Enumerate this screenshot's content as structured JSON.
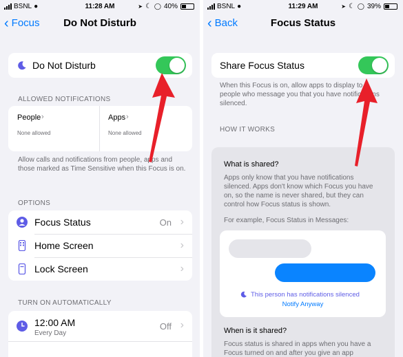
{
  "left": {
    "status": {
      "carrier": "BSNL",
      "time": "11:28 AM",
      "battery": "40%",
      "battery_level": 0.4
    },
    "nav": {
      "back_label": "Focus",
      "title": "Do Not Disturb"
    },
    "dnd_row": {
      "label": "Do Not Disturb",
      "toggle_on": true
    },
    "allowed": {
      "header": "ALLOWED NOTIFICATIONS",
      "people": {
        "title": "People",
        "sub": "None allowed"
      },
      "apps": {
        "title": "Apps",
        "sub": "None allowed"
      },
      "footer": "Allow calls and notifications from people, apps and those marked as Time Sensitive when this Focus is on."
    },
    "options": {
      "header": "OPTIONS",
      "items": [
        {
          "label": "Focus Status",
          "value": "On",
          "icon": "focus-status-icon"
        },
        {
          "label": "Home Screen",
          "value": "",
          "icon": "home-screen-icon"
        },
        {
          "label": "Lock Screen",
          "value": "",
          "icon": "lock-screen-icon"
        }
      ]
    },
    "auto": {
      "header": "TURN ON AUTOMATICALLY",
      "item": {
        "time": "12:00 AM",
        "sub": "Every Day",
        "value": "Off",
        "icon": "clock-icon"
      }
    }
  },
  "right": {
    "status": {
      "carrier": "BSNL",
      "time": "11:29 AM",
      "battery": "39%",
      "battery_level": 0.39
    },
    "nav": {
      "back_label": "Back",
      "title": "Focus Status"
    },
    "share_row": {
      "label": "Share Focus Status",
      "toggle_on": true
    },
    "share_footer": "When this Focus is on, allow apps to display to people who message you that you have notifications silenced.",
    "how_header": "HOW IT WORKS",
    "info": {
      "what_title": "What is shared?",
      "what_body": "Apps only know that you have notifications silenced. Apps don't know which Focus you have on, so the name is never shared, but they can control how Focus status is shown.",
      "example": "For example, Focus Status in Messages:",
      "silenced_text": "This person has notifications silenced",
      "notify_anyway": "Notify Anyway",
      "when_title": "When is it shared?",
      "when_body": "Focus status is shared in apps when you have a Focus turned on and after you give an app"
    }
  },
  "colors": {
    "accent": "#007aff",
    "toggle_green": "#34c759",
    "arrow_red": "#e8202a",
    "bubble_blue": "#0a84ff",
    "moon_purple": "#5e5ce6"
  }
}
